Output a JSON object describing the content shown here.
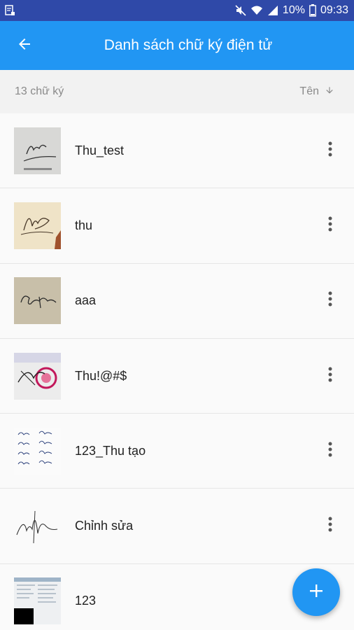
{
  "status_bar": {
    "battery": "10%",
    "time": "09:33",
    "icons": [
      "notification-icon",
      "mute-icon",
      "wifi-icon",
      "signal-icon",
      "battery-icon"
    ]
  },
  "app_bar": {
    "title": "Danh sách chữ ký điện tử",
    "back_icon": "arrow-back-icon"
  },
  "subheader": {
    "count": "13 chữ ký",
    "sort_label": "Tên",
    "sort_icon": "arrow-down-icon"
  },
  "signatures": [
    {
      "name": "Thu_test"
    },
    {
      "name": "thu"
    },
    {
      "name": "aaa"
    },
    {
      "name": "Thu!@#$"
    },
    {
      "name": "123_Thu tạo"
    },
    {
      "name": "Chỉnh sửa"
    },
    {
      "name": "123"
    }
  ],
  "fab": {
    "icon": "plus-icon"
  }
}
